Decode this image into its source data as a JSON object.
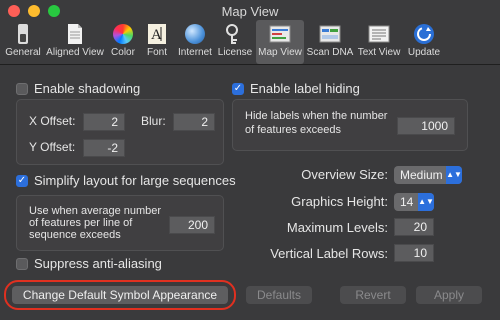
{
  "window": {
    "title": "Map View"
  },
  "toolbar": {
    "items": [
      {
        "label": "General",
        "icon": "switch-icon"
      },
      {
        "label": "Aligned View",
        "icon": "document-icon"
      },
      {
        "label": "Color",
        "icon": "color-wheel-icon"
      },
      {
        "label": "Font",
        "icon": "font-icon"
      },
      {
        "label": "Internet",
        "icon": "globe-icon"
      },
      {
        "label": "License",
        "icon": "license-icon"
      },
      {
        "label": "Map View",
        "icon": "map-view-icon",
        "selected": true
      },
      {
        "label": "Scan DNA",
        "icon": "scan-dna-icon"
      },
      {
        "label": "Text View",
        "icon": "text-view-icon"
      },
      {
        "label": "Update",
        "icon": "update-icon"
      }
    ]
  },
  "shadowing": {
    "checkbox_label": "Enable shadowing",
    "checked": false,
    "x_offset_label": "X Offset:",
    "x_offset_value": "2",
    "blur_label": "Blur:",
    "blur_value": "2",
    "y_offset_label": "Y Offset:",
    "y_offset_value": "-2"
  },
  "label_hiding": {
    "checkbox_label": "Enable label hiding",
    "checked": true,
    "description": "Hide labels when the number of features exceeds",
    "value": "1000"
  },
  "simplify": {
    "checkbox_label": "Simplify layout for large sequences",
    "checked": true,
    "description": "Use when average number of features per line of sequence exceeds",
    "value": "200"
  },
  "antialias": {
    "checkbox_label": "Suppress anti-aliasing",
    "checked": false
  },
  "settings": {
    "overview_size_label": "Overview Size:",
    "overview_size_value": "Medium",
    "graphics_height_label": "Graphics Height:",
    "graphics_height_value": "14",
    "max_levels_label": "Maximum Levels:",
    "max_levels_value": "20",
    "vertical_rows_label": "Vertical Label Rows:",
    "vertical_rows_value": "10"
  },
  "buttons": {
    "change_symbol": "Change Default Symbol Appearance",
    "defaults": "Defaults",
    "revert": "Revert",
    "apply": "Apply"
  },
  "colors": {
    "accent": "#2c6fdc",
    "highlight_ring": "#e03020"
  }
}
